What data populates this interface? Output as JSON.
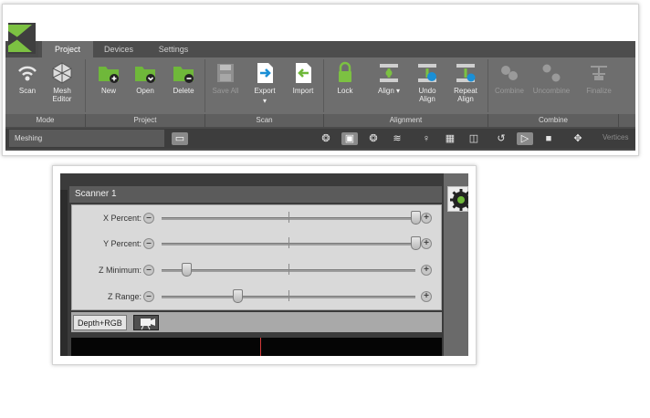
{
  "tabs": [
    {
      "label": "Project"
    },
    {
      "label": "Devices"
    },
    {
      "label": "Settings"
    }
  ],
  "tools": {
    "scan": "Scan",
    "mesh_editor": "Mesh\nEditor",
    "new": "New",
    "open": "Open",
    "delete": "Delete",
    "save_all": "Save All",
    "export": "Export",
    "import": "Import",
    "lock": "Lock",
    "align": "Align ▾",
    "undo_align": "Undo\nAlign",
    "repeat_align": "Repeat\nAlign",
    "combine": "Combine",
    "uncombine": "Uncombine",
    "finalize": "Finalize"
  },
  "groups": {
    "mode": "Mode",
    "project": "Project",
    "scan": "Scan",
    "alignment": "Alignment",
    "combine": "Combine"
  },
  "status": {
    "meshing": "Meshing",
    "vertices": "Vertices"
  },
  "scanner": {
    "title": "Scanner 1",
    "x_percent_label": "X Percent:",
    "y_percent_label": "Y Percent:",
    "z_minimum_label": "Z Minimum:",
    "z_range_label": "Z Range:",
    "x_percent_level": 1.0,
    "y_percent_level": 1.0,
    "z_minimum_level": 0.1,
    "z_range_level": 0.3,
    "tab_depth_rgb": "Depth+RGB"
  },
  "colors": {
    "accent_green": "#7cc142",
    "ribbon": "#6e6e6e",
    "dark": "#3d3d3d"
  }
}
